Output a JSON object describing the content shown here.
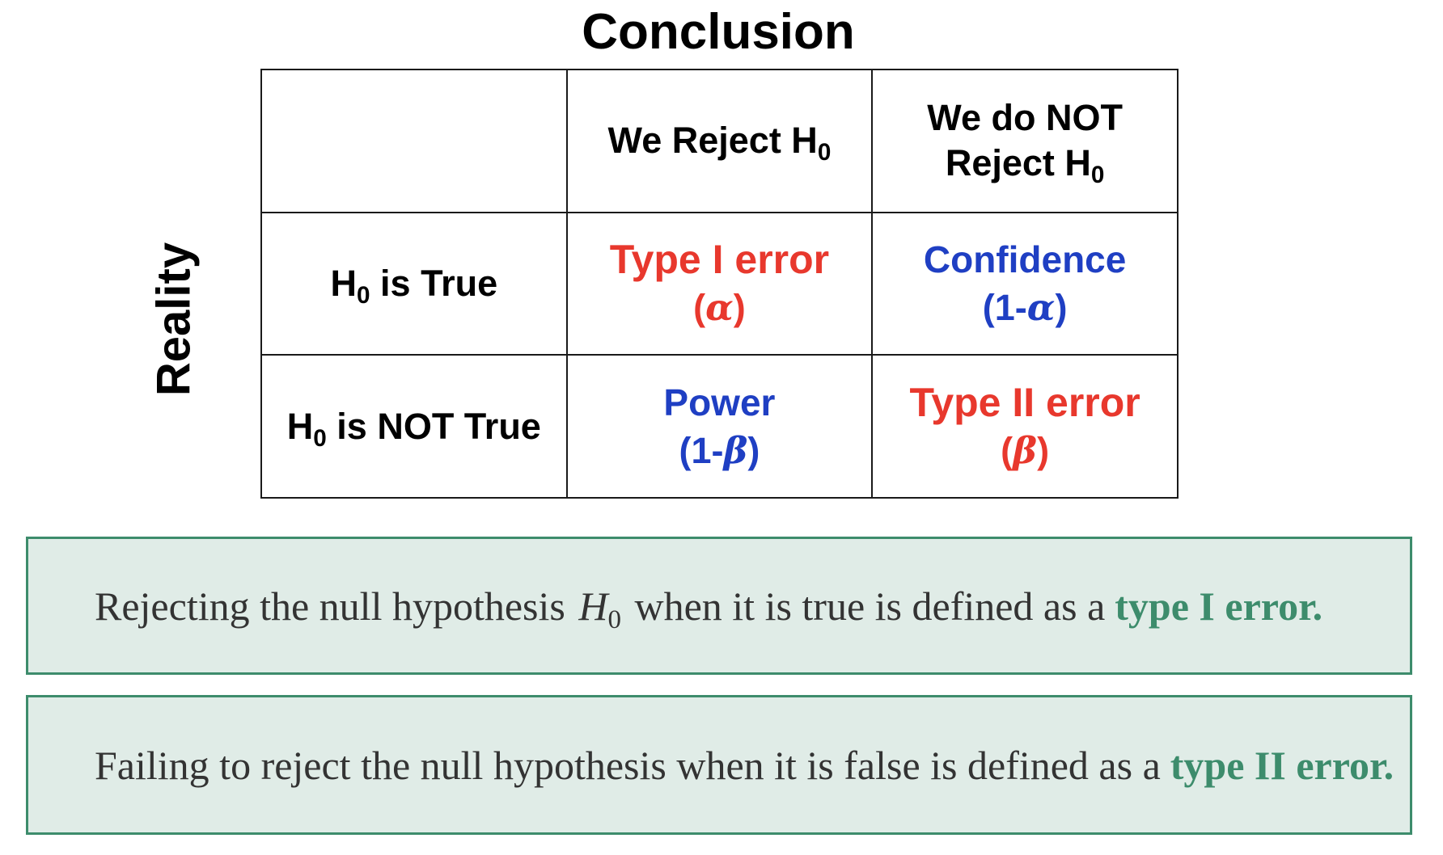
{
  "conclusion_title": "Conclusion",
  "reality_label": "Reality",
  "table": {
    "col_headers": [
      {
        "text": "We Reject H",
        "sub": "0"
      },
      {
        "line1": "We do NOT",
        "line2": "Reject H",
        "sub": "0"
      }
    ],
    "rows": [
      {
        "header": {
          "pre": "H",
          "sub": "0",
          "post": " is True"
        },
        "cells": [
          {
            "main": "Type I error",
            "sub_open": "(",
            "greek": "α",
            "sub_close": ")",
            "color": "#e8382d"
          },
          {
            "main": "Confidence",
            "sub_open": "(1-",
            "greek": "α",
            "sub_close": ")",
            "color": "#1f3fc3"
          }
        ]
      },
      {
        "header": {
          "pre": "H",
          "sub": "0",
          "post": " is NOT True"
        },
        "cells": [
          {
            "main": "Power",
            "sub_open": "(1-",
            "greek": "β",
            "sub_close": ")",
            "color": "#1f3fc3"
          },
          {
            "main": "Type II error",
            "sub_open": "(",
            "greek": "β",
            "sub_close": ")",
            "color": "#e8382d"
          }
        ]
      }
    ]
  },
  "definitions": [
    {
      "before": "Rejecting the null hypothesis",
      "math": "H",
      "math_sub": "0",
      "after": "when it is true is defined as a",
      "term": "type I error."
    },
    {
      "before": "Failing to reject the null hypothesis when it is false is defined as a",
      "term": "type II error."
    }
  ],
  "colors": {
    "error_red": "#e8382d",
    "good_blue": "#1f3fc3",
    "box_fill": "#e0ece7",
    "box_border": "#3d8c6c",
    "term_green": "#3d8c6c"
  }
}
